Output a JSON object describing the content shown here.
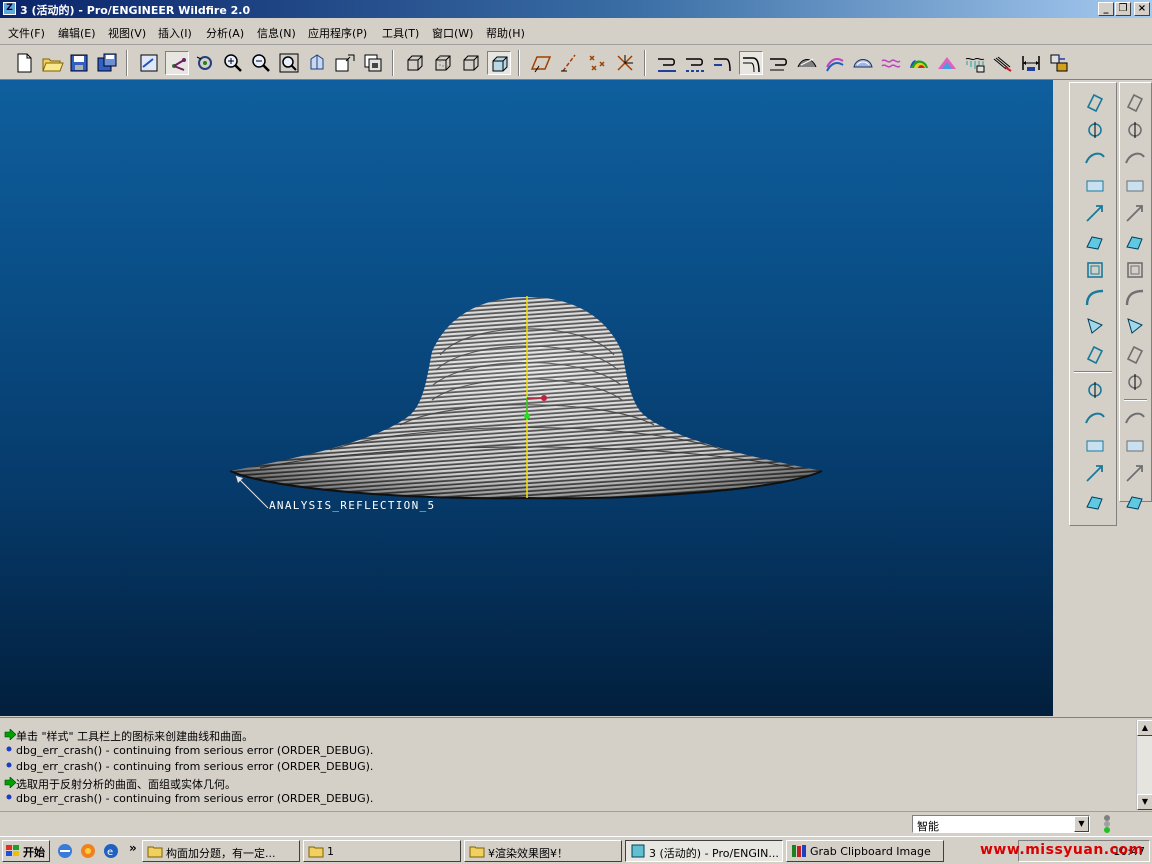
{
  "window": {
    "title": "3 (活动的) - Pro/ENGINEER Wildfire 2.0",
    "controls": {
      "minimize": "_",
      "restore": "❐",
      "close": "×"
    }
  },
  "menu": [
    "文件(F)",
    "编辑(E)",
    "视图(V)",
    "插入(I)",
    "分析(A)",
    "信息(N)",
    "应用程序(P)",
    "工具(T)",
    "窗口(W)",
    "帮助(H)"
  ],
  "toolbar": {
    "groups": [
      [
        "new-icon",
        "open-icon",
        "save-icon",
        "save-copy-icon"
      ],
      [
        "redraw-icon",
        "spin-center-icon",
        "orient-icon",
        "zoom-in-icon",
        "zoom-out-icon",
        "refit-icon",
        "reorient-icon",
        "saved-views-icon",
        "layers-icon"
      ],
      [
        "wireframe-icon",
        "hidden-line-icon",
        "no-hidden-icon",
        "shading-icon"
      ],
      [
        "datum-planes-icon",
        "datum-axes-icon",
        "datum-points-icon",
        "coordinate-systems-icon"
      ],
      [
        "analysis-1-icon",
        "analysis-2-icon",
        "analysis-3-icon",
        "analysis-4-icon",
        "analysis-5-icon",
        "analysis-6-icon",
        "analysis-7-icon",
        "analysis-8-icon",
        "analysis-9-icon",
        "analysis-10-icon",
        "analysis-11-icon",
        "analysis-12-icon",
        "analysis-13-icon",
        "analysis-14-icon",
        "analysis-15-icon"
      ]
    ]
  },
  "viewport": {
    "annotation": "ANALYSIS_REFLECTION_5"
  },
  "right_toolbar_1": [
    "curve-icon",
    "revolve-icon",
    "sweep-icon",
    "boundary-icon",
    "offset-icon",
    "solidify-icon",
    "shell-icon",
    "round-icon",
    "draft-icon",
    "merge-icon",
    "sketch-curve-icon",
    "plane-icon",
    "axis-icon",
    "datum-curve-icon",
    "point-icon"
  ],
  "right_toolbar_2": [
    "style-icon",
    "edit-definition-icon",
    "hole-icon",
    "rib-icon",
    "pattern-icon",
    "mirror-icon",
    "trim-icon",
    "extend-icon",
    "intersect-icon",
    "project-icon",
    "table-icon",
    "delete-icon",
    "undo-icon",
    "redo-icon",
    "regen-icon"
  ],
  "messages": [
    {
      "type": "prompt",
      "text": "单击 \"样式\" 工具栏上的图标来创建曲线和曲面。"
    },
    {
      "type": "info",
      "text": "dbg_err_crash() - continuing from serious error (ORDER_DEBUG)."
    },
    {
      "type": "info",
      "text": "dbg_err_crash() - continuing from serious error (ORDER_DEBUG)."
    },
    {
      "type": "prompt",
      "text": "选取用于反射分析的曲面、面组或实体几何。"
    },
    {
      "type": "info",
      "text": "dbg_err_crash() - continuing from serious error (ORDER_DEBUG)."
    }
  ],
  "status": {
    "filter_value": "智能"
  },
  "taskbar": {
    "start_label": "开始",
    "tasks": [
      {
        "label": "构面加分题，有一定...",
        "icon": "folder-icon"
      },
      {
        "label": "1",
        "icon": "folder-icon"
      },
      {
        "label": "¥渲染效果图¥！",
        "icon": "folder-icon"
      },
      {
        "label": "3 (活动的) - Pro/ENGIN...",
        "icon": "proe-icon",
        "active": true
      },
      {
        "label": "Grab Clipboard Image",
        "icon": "books-icon"
      }
    ],
    "time": "10:47"
  },
  "watermark": "www.missyuan.com",
  "colors": {
    "titlebar": "#0a246a",
    "viewport_top": "#0f5f9e",
    "viewport_bottom": "#021f3c",
    "axis_yellow": "#f0e000",
    "prompt_green": "#00a000"
  }
}
